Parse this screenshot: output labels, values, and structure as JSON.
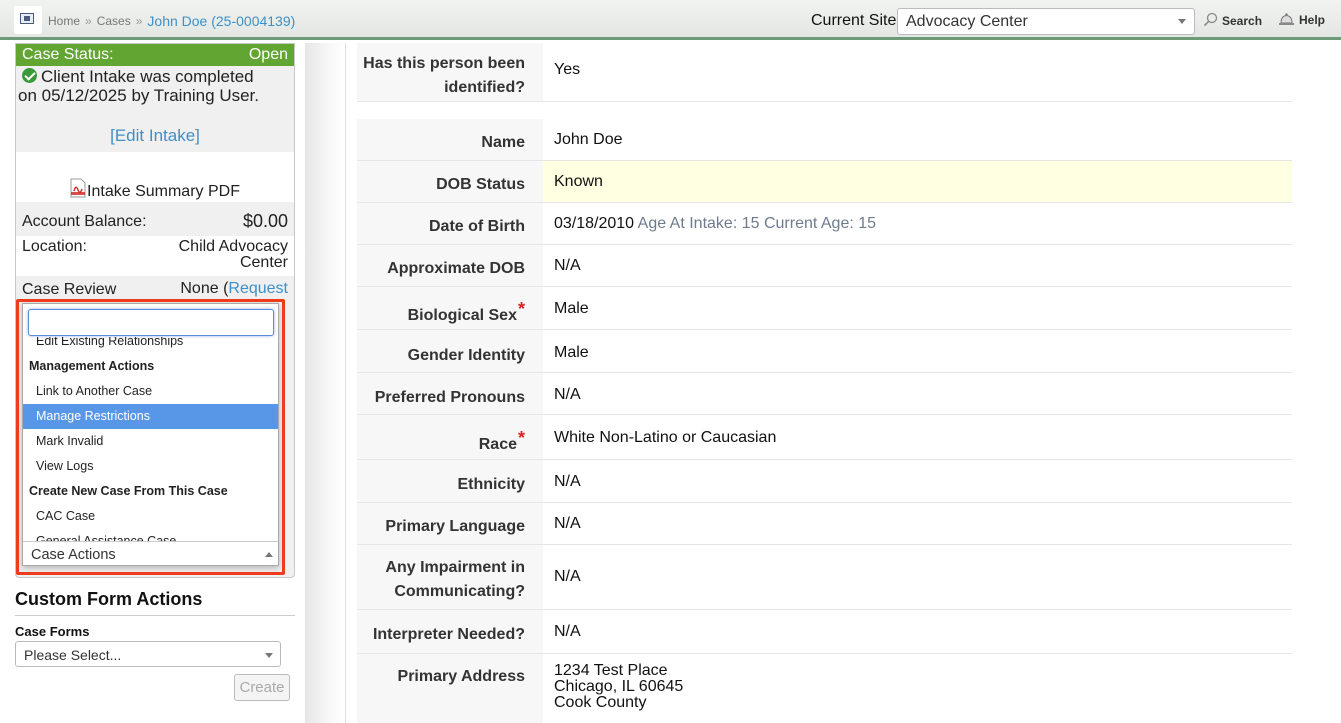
{
  "topbar": {
    "breadcrumb_home": "Home",
    "breadcrumb_sep": "»",
    "breadcrumb_cases": "Cases",
    "breadcrumb_case": "John Doe (25-0004139)",
    "current_site_label": "Current Site",
    "current_site_value": "Advocacy Center",
    "search_label": "Search",
    "help_label": "Help"
  },
  "sidebar": {
    "case_status_label": "Case Status:",
    "case_status_value": "Open",
    "intake_line1": "Client Intake was completed",
    "intake_line2": "on 05/12/2025 by Training User.",
    "edit_intake": "[Edit Intake]",
    "intake_pdf": "Intake Summary PDF",
    "account_balance_label": "Account Balance:",
    "account_balance_value": "$0.00",
    "location_label": "Location:",
    "location_value_line1": "Child Advocacy",
    "location_value_line2": "Center",
    "case_review_label": "Case Review",
    "case_review_value": "None (",
    "case_review_link": "Request"
  },
  "case_actions": {
    "search_value": "",
    "items": [
      {
        "label": "Edit Existing Relationships",
        "type": "option"
      },
      {
        "label": "Management Actions",
        "type": "group"
      },
      {
        "label": "Link to Another Case",
        "type": "option"
      },
      {
        "label": "Manage Restrictions",
        "type": "option",
        "highlighted": true
      },
      {
        "label": "Mark Invalid",
        "type": "option"
      },
      {
        "label": "View Logs",
        "type": "option"
      },
      {
        "label": "Create New Case From This Case",
        "type": "group"
      },
      {
        "label": "CAC Case",
        "type": "option"
      },
      {
        "label": "General Assistance Case",
        "type": "option"
      }
    ],
    "selected_label": "Case Actions"
  },
  "custom_forms": {
    "title": "Custom Form Actions",
    "case_forms_label": "Case Forms",
    "case_forms_value": "Please Select...",
    "create_label": "Create"
  },
  "fields": {
    "identified": {
      "label_line1": "Has this person been",
      "label_line2": "identified?",
      "value": "Yes"
    },
    "name": {
      "label": "Name",
      "value": "John Doe"
    },
    "dob_status": {
      "label": "DOB Status",
      "value": "Known"
    },
    "dob": {
      "label": "Date of Birth",
      "value": "03/18/2010",
      "extra": "Age At Intake: 15 Current Age: 15"
    },
    "approx_dob": {
      "label": "Approximate DOB",
      "value": "N/A"
    },
    "bio_sex": {
      "label": "Biological Sex",
      "required": "*",
      "value": "Male"
    },
    "gender_identity": {
      "label": "Gender Identity",
      "value": "Male"
    },
    "pronouns": {
      "label": "Preferred Pronouns",
      "value": "N/A"
    },
    "race": {
      "label": "Race",
      "required": "*",
      "value": "White Non-Latino or Caucasian"
    },
    "ethnicity": {
      "label": "Ethnicity",
      "value": "N/A"
    },
    "language": {
      "label": "Primary Language",
      "value": "N/A"
    },
    "impairment": {
      "label_line1": "Any Impairment in",
      "label_line2": "Communicating?",
      "value": "N/A"
    },
    "interpreter": {
      "label": "Interpreter Needed?",
      "value": "N/A"
    },
    "address": {
      "label": "Primary Address",
      "line1": "1234 Test Place",
      "line2": "Chicago, IL 60645",
      "line3": "Cook County"
    }
  },
  "colors": {
    "status_green": "#63a533",
    "link_blue": "#3f8fc6",
    "highlight_blue": "#5896e8",
    "annotation_red": "#f03c1e",
    "required_red": "#e02020"
  }
}
